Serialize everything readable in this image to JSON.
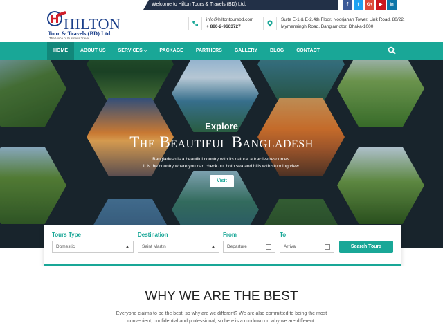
{
  "topbar": {
    "welcome": "Welcome to Hilton Tours & Travels (BD) Ltd.",
    "social": [
      {
        "icon": "facebook-icon",
        "glyph": "f",
        "color": "#3b5998"
      },
      {
        "icon": "twitter-icon",
        "glyph": "t",
        "color": "#1da1f2"
      },
      {
        "icon": "google-plus-icon",
        "glyph": "G+",
        "color": "#dd4b39"
      },
      {
        "icon": "youtube-icon",
        "glyph": "▶",
        "color": "#cc181e"
      },
      {
        "icon": "linkedin-icon",
        "glyph": "in",
        "color": "#0e76a8"
      }
    ]
  },
  "header": {
    "logo_brand": "HILTON",
    "logo_sub": "Tour & Travels (BD) Ltd.",
    "logo_tag": "The Voice of Business Travel",
    "email": "info@hiltontoursbd.com",
    "phone": "+ 880-2-9663727",
    "address_line1": "Suite E-1 & E-2,4th Floor, Noorjahan Tower, Link Road, 80/22,",
    "address_line2": "Mymensingh Road, Banglamotor, Dhaka-1000"
  },
  "nav": {
    "items": [
      "HOME",
      "ABOUT US",
      "SERVICES",
      "PACKAGE",
      "PARTHERS",
      "GALLERY",
      "BLOG",
      "CONTACT"
    ],
    "active": 0,
    "dropdown_index": 2
  },
  "hero": {
    "explore": "Explore",
    "headline": "The Beautiful Bangladesh",
    "desc_line1": "Bangladesh is a beautiful country with its natural attractive resources.",
    "desc_line2": "It is the country where you can check out both sea and hills with stunning view.",
    "visit_label": "Visit"
  },
  "search": {
    "tours_label": "Tours Type",
    "tours_value": "Domestic",
    "destination_label": "Destination",
    "destination_value": "Saint Martin",
    "from_label": "From",
    "from_placeholder": "Departure",
    "to_label": "To",
    "to_placeholder": "Arrival",
    "button": "Search Tours"
  },
  "why": {
    "title": "WHY WE ARE THE BEST",
    "text_line1": "Everyone claims to be the best, so why are we different? We are also committed to being the most",
    "text_line2": "convenient, confidential and professional, so here is a rundown on why we are different."
  },
  "colors": {
    "accent": "#19a797",
    "navy": "#223047",
    "brand_blue": "#1b3f8a",
    "brand_red": "#d11f2b"
  }
}
